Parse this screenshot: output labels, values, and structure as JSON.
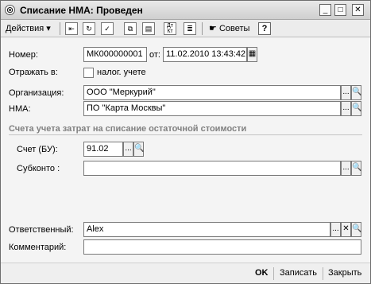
{
  "window": {
    "title": "Списание НМА: Проведен",
    "icon_glyph": "◎",
    "minimize_glyph": "_",
    "maximize_glyph": "□",
    "close_glyph": "✕"
  },
  "toolbar": {
    "actions_label": "Действия",
    "actions_arrow": "▾",
    "tips_label": "Советы",
    "help_label": "?",
    "dtkt_label": "Дт Кт",
    "icons": [
      "arrow-left-icon",
      "refresh-icon",
      "post-icon",
      "copy-icon",
      "doc-icon",
      "dtkt-icon",
      "report-icon",
      "tips-icon",
      "help-icon"
    ]
  },
  "form": {
    "number_label": "Номер:",
    "number_value": "МК000000001",
    "from_label": "от:",
    "date_value": "11.02.2010 13:43:42",
    "reflect_label": "Отражать в:",
    "tax_checkbox_label": "налог. учете",
    "tax_checked": false,
    "organization_label": "Организация:",
    "organization_value": "ООО \"Меркурий\"",
    "nma_label": "НМА:",
    "nma_value": "ПО \"Карта Москвы\"",
    "section_title": "Счета учета затрат на списание остаточной стоимости",
    "account_label": "Счет (БУ):",
    "account_value": "91.02",
    "subconto_label": "Субконто :",
    "subconto_value": "",
    "responsible_label": "Ответственный:",
    "responsible_value": "Alex",
    "comment_label": "Комментарий:",
    "comment_value": "",
    "select_glyph": "...",
    "search_glyph": "🔍",
    "clear_glyph": "✕",
    "calendar_glyph": "▦"
  },
  "bottom": {
    "ok_label": "OK",
    "save_label": "Записать",
    "close_label": "Закрыть"
  }
}
